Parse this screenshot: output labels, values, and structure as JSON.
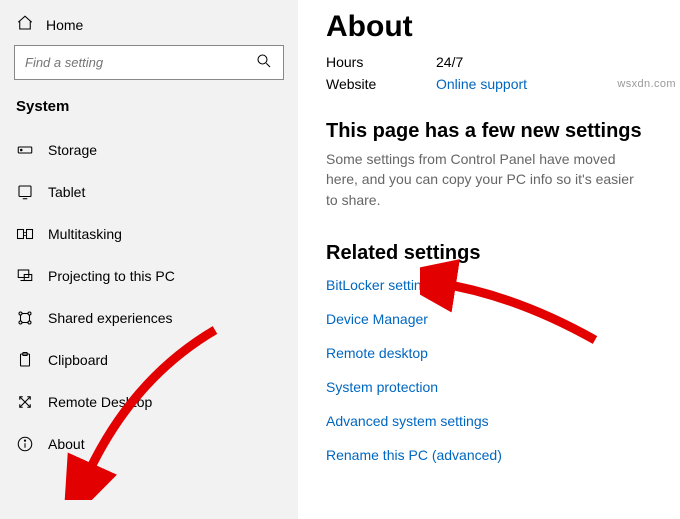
{
  "sidebar": {
    "home_label": "Home",
    "search_placeholder": "Find a setting",
    "category_label": "System",
    "items": [
      {
        "label": "Storage"
      },
      {
        "label": "Tablet"
      },
      {
        "label": "Multitasking"
      },
      {
        "label": "Projecting to this PC"
      },
      {
        "label": "Shared experiences"
      },
      {
        "label": "Clipboard"
      },
      {
        "label": "Remote Desktop"
      },
      {
        "label": "About"
      }
    ]
  },
  "main": {
    "title": "About",
    "hours_key": "Hours",
    "hours_val": "24/7",
    "website_key": "Website",
    "website_val": "Online support",
    "new_settings_heading": "This page has a few new settings",
    "new_settings_body": "Some settings from Control Panel have moved here, and you can copy your PC info so it's easier to share.",
    "related_heading": "Related settings",
    "related_links": [
      "BitLocker settings",
      "Device Manager",
      "Remote desktop",
      "System protection",
      "Advanced system settings",
      "Rename this PC (advanced)"
    ]
  },
  "watermark": "wsxdn.com"
}
